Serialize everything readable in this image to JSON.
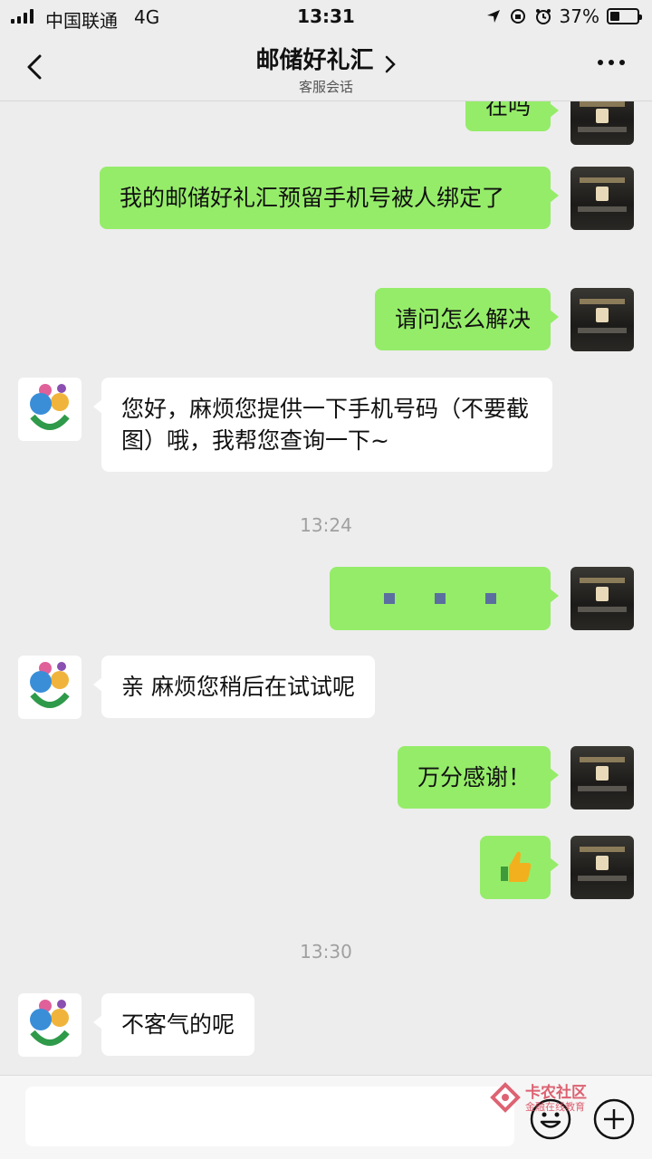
{
  "status_bar": {
    "carrier": "中国联通",
    "network": "4G",
    "time": "13:31",
    "battery": "37%",
    "battery_level": 0.37
  },
  "nav": {
    "title": "邮储好礼汇",
    "subtitle": "客服会话"
  },
  "messages": [
    {
      "from": "user",
      "text": "在吗"
    },
    {
      "from": "user",
      "text": "我的邮储好礼汇预留手机号被人绑定了"
    },
    {
      "from": "user",
      "text": "请问怎么解决"
    },
    {
      "from": "service",
      "text": "您好，麻烦您提供一下手机号码（不要截图）哦，我帮您查询一下~"
    },
    {
      "from": "user",
      "text": "万分感谢！"
    },
    {
      "from": "service",
      "text": "亲 麻烦您稍后在试试呢"
    },
    {
      "from": "service",
      "text": "不客气的呢"
    }
  ],
  "timestamps": [
    "13:24",
    "13:30"
  ],
  "thumbs_up_emoji": "👍",
  "watermark": {
    "title": "卡农社区",
    "subtitle": "金融在线教育"
  },
  "colors": {
    "outgoing_bubble": "#95ec69",
    "incoming_bubble": "#ffffff",
    "background": "#ededed"
  }
}
